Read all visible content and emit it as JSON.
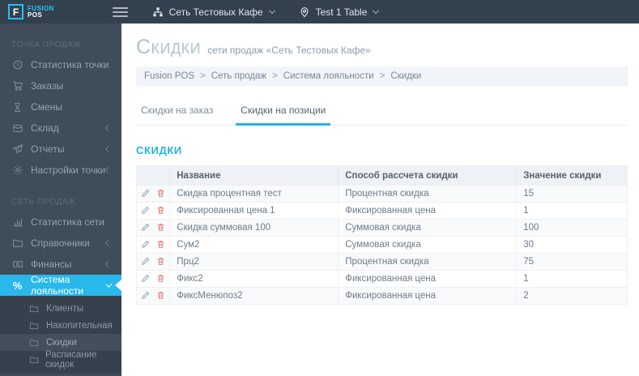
{
  "colors": {
    "accent": "#29b8ec",
    "topbar_bg": "#33414f",
    "sidebar_bg": "#3f4c5a",
    "danger": "#e4827c"
  },
  "icons": {
    "percent_glyph": "%"
  },
  "topbar": {
    "logo": {
      "letter": "F",
      "brand_line1": "FUSION",
      "brand_line2": "POS"
    },
    "network_selector": "Сеть Тестовых Кафе",
    "location_selector": "Test 1 Table"
  },
  "sidebar": {
    "sections": [
      {
        "title": "ТОЧКА ПРОДАЖ",
        "items": [
          {
            "label": "Статистика точки"
          },
          {
            "label": "Заказы"
          },
          {
            "label": "Смены"
          },
          {
            "label": "Склад"
          },
          {
            "label": "Отчеты"
          },
          {
            "label": "Настройки точки"
          }
        ]
      },
      {
        "title": "СЕТЬ ПРОДАЖ",
        "items": [
          {
            "label": "Статистика сети"
          },
          {
            "label": "Справочники"
          },
          {
            "label": "Финансы"
          },
          {
            "label": "Система лояльности"
          }
        ]
      }
    ],
    "submenu": [
      {
        "label": "Клиенты"
      },
      {
        "label": "Накопительная"
      },
      {
        "label": "Скидки"
      },
      {
        "label": "Расписание скидок"
      }
    ]
  },
  "page": {
    "title": "Скидки",
    "subtitle": "сети продаж «Сеть Тестовых Кафе»",
    "breadcrumb": {
      "items": [
        "Fusion POS",
        "Сеть продаж",
        "Система лояльности",
        "Скидки"
      ],
      "separator": ">"
    },
    "tabs": [
      {
        "label": "Скидки на заказ"
      },
      {
        "label": "Скидки на позиции"
      }
    ],
    "active_tab": "Скидки на позиции",
    "section_title": "СКИДКИ"
  },
  "table": {
    "columns": [
      "Название",
      "Способ рассчета скидки",
      "Значение скидки"
    ],
    "rows": [
      {
        "name": "Скидка процентная тест",
        "method": "Процентная скидка",
        "value": "15"
      },
      {
        "name": "Фиксированная цена 1",
        "method": "Фиксированная цена",
        "value": "1"
      },
      {
        "name": "Скидка суммовая 100",
        "method": "Суммовая скидка",
        "value": "100"
      },
      {
        "name": "Сум2",
        "method": "Суммовая скидка",
        "value": "30"
      },
      {
        "name": "Прц2",
        "method": "Процентная скидка",
        "value": "75"
      },
      {
        "name": "Фикс2",
        "method": "Фиксированная цена",
        "value": "1"
      },
      {
        "name": "ФиксМенюпоз2",
        "method": "Фиксированная цена",
        "value": "2"
      }
    ]
  }
}
